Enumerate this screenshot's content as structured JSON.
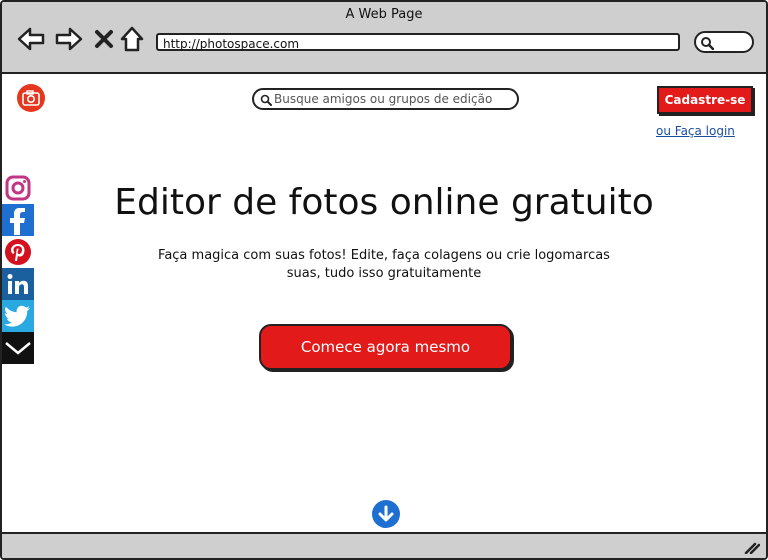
{
  "window": {
    "title": "A Web Page",
    "url": "http://photospace.com"
  },
  "header": {
    "logo_icon": "camera-icon",
    "brand_colors": {
      "logo": "#e5371e",
      "primary": "#e21a1a",
      "link": "#1a4e9e"
    },
    "search_placeholder": "Busque amigos ou grupos de edição",
    "signup_label": "Cadastre-se",
    "login_label": "ou Faça login"
  },
  "social": [
    {
      "name": "instagram-icon",
      "color": "#c13584"
    },
    {
      "name": "facebook-icon",
      "color": "#1f6fd1"
    },
    {
      "name": "pinterest-icon",
      "color": "#d4111e"
    },
    {
      "name": "linkedin-icon",
      "color": "#1a5f9e"
    },
    {
      "name": "twitter-icon",
      "color": "#2aa9e0"
    },
    {
      "name": "chevron-down-icon",
      "color": "#111111"
    }
  ],
  "hero": {
    "headline": "Editor de fotos online gratuito",
    "subtext_line1": "Faça magica com suas fotos! Edite, faça colagens ou crie logomarcas",
    "subtext_line2": "suas, tudo isso gratuitamente",
    "cta_label": "Comece agora mesmo"
  }
}
